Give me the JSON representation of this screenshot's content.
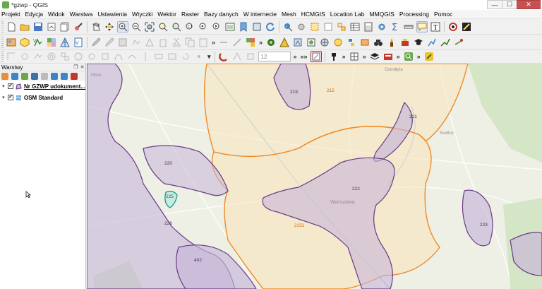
{
  "window": {
    "title": "*gzwp - QGIS",
    "minimize": "—",
    "maximize": "☐",
    "close": "✕"
  },
  "menu": [
    "Projekt",
    "Edycja",
    "Widok",
    "Warstwa",
    "Ustawienia",
    "Wtyczki",
    "Wektor",
    "Raster",
    "Bazy danych",
    "W internecie",
    "Mesh",
    "HCMGIS",
    "Location Lab",
    "MMQGIS",
    "Processing",
    "Pomoc"
  ],
  "toolbar3": {
    "spin_value": "12"
  },
  "layers_panel": {
    "title": "Warstwy",
    "layers": [
      {
        "label": "Nr GZWP udokument...",
        "checked": true,
        "expanded": true
      },
      {
        "label": "OSM Standard",
        "checked": true,
        "expanded": true
      }
    ]
  },
  "map": {
    "polygon_labels": [
      "219",
      "215",
      "221",
      "220",
      "222",
      "2151",
      "223",
      "226",
      "402",
      "225"
    ],
    "basemap_labels": [
      "Ostrołęka",
      "Warszawa",
      "Siedlce",
      "Płock"
    ],
    "colors": {
      "purple_fill": "#c6b6d8",
      "purple_stroke": "#6a3a85",
      "orange_fill": "#f8e5bc",
      "orange_stroke": "#f08a28",
      "teal_stroke": "#1a9a8c"
    }
  }
}
